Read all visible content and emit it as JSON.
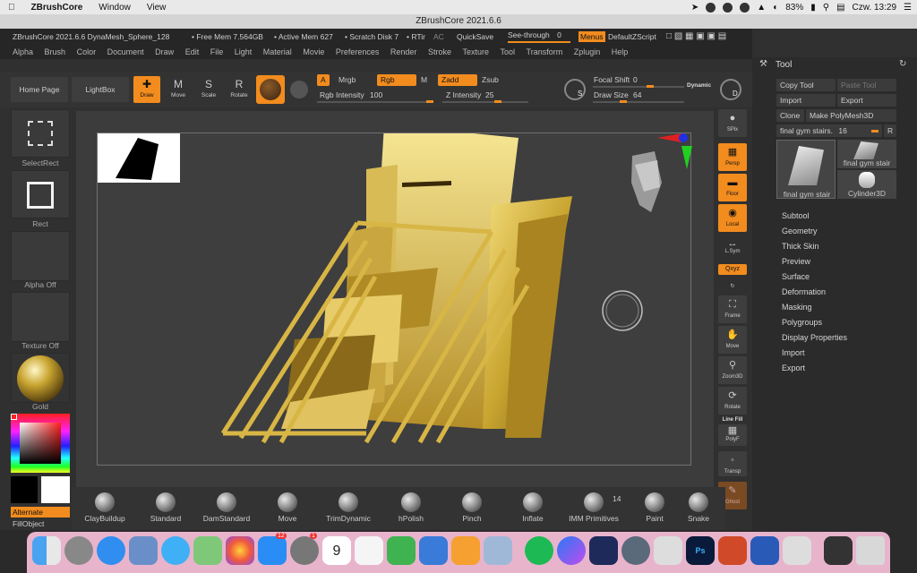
{
  "macmenu": {
    "apple_icon": "apple-icon",
    "app": "ZBrushCore",
    "items": [
      "Window",
      "View"
    ],
    "battery": "83%",
    "clock": "Czw. 13:29"
  },
  "window": {
    "title": "ZBrushCore 2021.6.6"
  },
  "infobar": {
    "info": "ZBrushCore 2021.6.6 DynaMesh_Sphere_128",
    "free_mem": "• Free Mem 7.564GB",
    "active_mem": "• Active Mem 627",
    "scratch": "• Scratch Disk 7",
    "rtime": "• RTir",
    "ac": "AC",
    "quicksave": "QuickSave",
    "see_through_label": "See-through",
    "see_through_value": "0",
    "menus": "Menus",
    "default_zscript": "DefaultZScript"
  },
  "menus": [
    "Alpha",
    "Brush",
    "Color",
    "Document",
    "Draw",
    "Edit",
    "File",
    "Light",
    "Material",
    "Movie",
    "Preferences",
    "Render",
    "Stroke",
    "Texture",
    "Tool",
    "Transform",
    "Zplugin",
    "Help"
  ],
  "toolbar": {
    "home_page": "Home Page",
    "lightbox": "LightBox",
    "draw": "Draw",
    "move": "Move",
    "scale": "Scale",
    "rotate": "Rotate",
    "a": "A",
    "mrgb": "Mrgb",
    "rgb": "Rgb",
    "m": "M",
    "zadd": "Zadd",
    "zsub": "Zsub",
    "rgb_intensity_label": "Rgb Intensity",
    "rgb_intensity": "100",
    "z_intensity_label": "Z Intensity",
    "z_intensity": "25",
    "focal_shift_label": "Focal Shift",
    "focal_shift": "0",
    "draw_size_label": "Draw Size",
    "draw_size": "64",
    "dynamic": "Dynamic",
    "s": "S",
    "d": "D"
  },
  "leftpanel": {
    "select_rect": "SelectRect",
    "rect": "Rect",
    "alpha_off": "Alpha Off",
    "texture_off": "Texture Off",
    "gold": "Gold",
    "alternate": "Alternate",
    "fillobject": "FillObject"
  },
  "rightshelf": [
    "SPix",
    "Persp",
    "Floor",
    "Local",
    "L.Sym",
    "Qxyz",
    "Frame",
    "Move",
    "Zoom3D",
    "Rotate",
    "Line Fill",
    "PolyF",
    "Transp",
    "Ghost"
  ],
  "toolpanel": {
    "header": "Tool",
    "copy_tool": "Copy Tool",
    "paste_tool": "Paste Tool",
    "import": "Import",
    "export": "Export",
    "clone": "Clone",
    "make_polymesh": "Make PolyMesh3D",
    "current_tool_label": "final gym stairs.",
    "current_tool_value": "16",
    "r": "R",
    "thumb1": "final gym stair",
    "thumb2": "final gym stair",
    "thumb3": "Cylinder3D",
    "sections": [
      "Subtool",
      "Geometry",
      "Thick Skin",
      "Preview",
      "Surface",
      "Deformation",
      "Masking",
      "Polygroups",
      "Display Properties",
      "Import",
      "Export"
    ]
  },
  "brushes": [
    {
      "name": "ClayBuildup"
    },
    {
      "name": "Standard"
    },
    {
      "name": "DamStandard"
    },
    {
      "name": "Move"
    },
    {
      "name": "TrimDynamic"
    },
    {
      "name": "hPolish"
    },
    {
      "name": "Pinch"
    },
    {
      "name": "Inflate"
    },
    {
      "name": "IMM Primitives",
      "count": "14"
    },
    {
      "name": "Paint"
    },
    {
      "name": "Snake"
    }
  ],
  "dock": {
    "badge_appstore": "12",
    "badge_prefs": "1",
    "calendar_day": "9",
    "apps": [
      "finder",
      "launchpad",
      "safari",
      "preview",
      "messages",
      "maps",
      "photos",
      "appstore",
      "system-prefs",
      "calendar",
      "reminders",
      "numbers",
      "keynote",
      "pages",
      "image-capture",
      "spotify",
      "messenger",
      "helium",
      "quicktime",
      "zbrush",
      "photoshop",
      "powerpoint",
      "word",
      "zbrushcore",
      "wacom",
      "trash"
    ]
  },
  "colors": {
    "accent": "#f28c1e",
    "gold": "#c9a530"
  }
}
